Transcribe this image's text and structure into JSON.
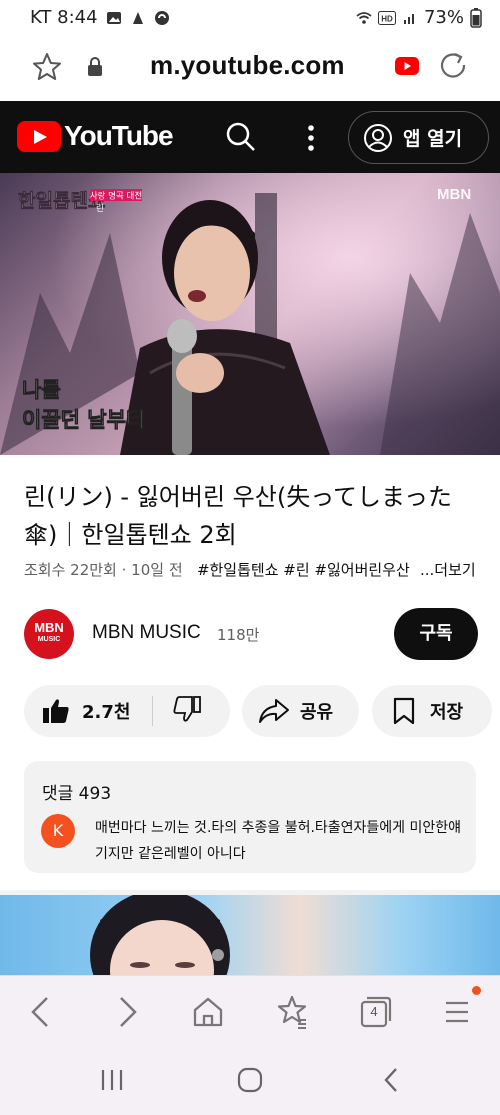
{
  "status_bar": {
    "carrier_time": "KT 8:44",
    "battery": "73%"
  },
  "browser": {
    "url": "m.youtube.com"
  },
  "youtube_header": {
    "logo_text": "YouTube",
    "open_app_label": "앱 열기"
  },
  "video": {
    "channel_watermark": "MBN",
    "show_logo": "한일톱텐쇼",
    "show_tag": "사랑 명곡 대전",
    "show_tag_sub": "린",
    "caption_line1": "나를",
    "caption_line2": "이끌던 날부터"
  },
  "title": {
    "text": "린(リン) - 잃어버린 우산(失ってしまった傘)｜한일톱텐쇼 2회"
  },
  "meta": {
    "views_date": "조회수 22만회 · 10일 전",
    "hashtags": "#한일톱텐쇼 #린 #잃어버린우산",
    "more_label": "...더보기"
  },
  "channel": {
    "avatar_line1": "MBN",
    "avatar_line2": "MUSIC",
    "name": "MBN MUSIC",
    "subscribers": "118만",
    "subscribe_label": "구독"
  },
  "actions": {
    "like_count": "2.7천",
    "share_label": "공유",
    "save_label": "저장"
  },
  "comments": {
    "header": "댓글 493",
    "avatar_letter": "K",
    "top_comment": "매번마다 느끼는 것.타의 추종을 불허.타출연자들에게 미안한얘기지만 같은레벨이 아니다"
  },
  "browser_bottom": {
    "tab_count": "4"
  },
  "colors": {
    "youtube_red": "#FF0000",
    "header_bg": "#0F0F0F",
    "notification_dot": "#F4511E"
  }
}
